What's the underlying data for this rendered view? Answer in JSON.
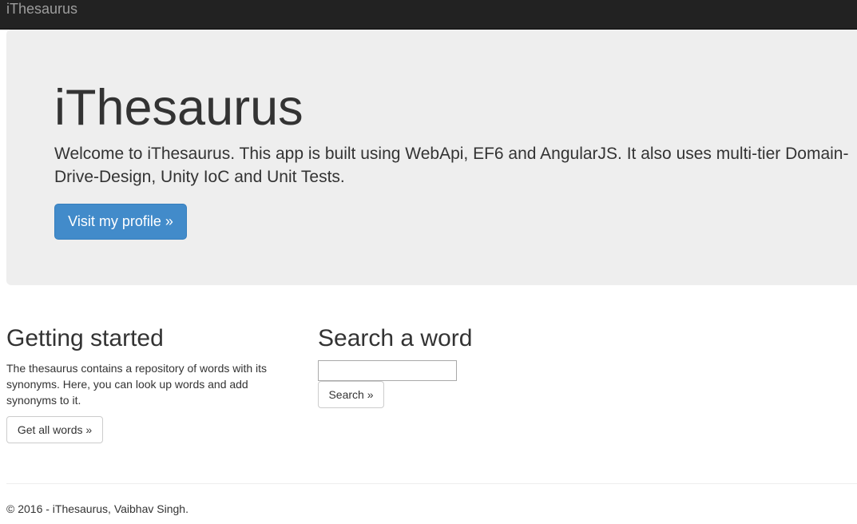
{
  "navbar": {
    "brand": "iThesaurus"
  },
  "jumbotron": {
    "title": "iThesaurus",
    "lead": "Welcome to iThesaurus. This app is built using WebApi, EF6 and AngularJS. It also uses multi-tier Domain-Drive-Design, Unity IoC and Unit Tests.",
    "button_label": "Visit my profile »"
  },
  "getting_started": {
    "title": "Getting started",
    "text": "The thesaurus contains a repository of words with its synonyms. Here, you can look up words and add synonyms to it.",
    "button_label": "Get all words »"
  },
  "search": {
    "title": "Search a word",
    "input_value": "",
    "button_label": "Search »"
  },
  "footer": {
    "text": "© 2016 - iThesaurus, Vaibhav Singh."
  },
  "colors": {
    "navbar_bg": "#222222",
    "brand_text": "#9d9d9d",
    "jumbotron_bg": "#eeeeee",
    "primary": "#428bca"
  }
}
